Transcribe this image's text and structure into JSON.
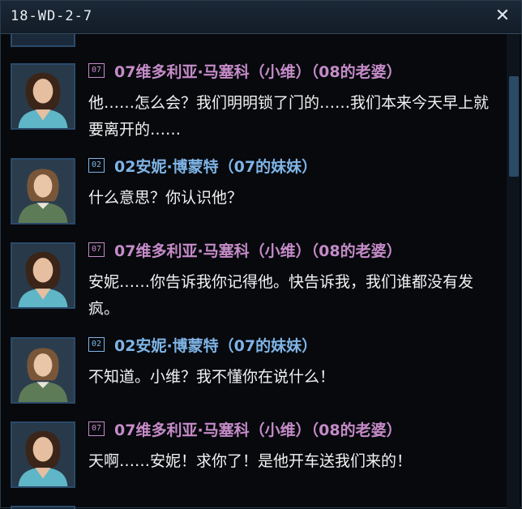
{
  "window": {
    "title": "18-WD-2-7",
    "close_icon": "close-icon"
  },
  "colors": {
    "speaker_07": "#c58bc8",
    "speaker_02": "#7fb4e6",
    "text": "#f2f2f2"
  },
  "entries": [
    {
      "badge": "07",
      "speaker": "07维多利亚·马塞科（小维）（08的老婆）",
      "text": "他……怎么会？我们明明锁了门的……我们本来今天早上就要离开的……"
    },
    {
      "badge": "02",
      "speaker": "02安妮·博蒙特（07的妹妹）",
      "text": "什么意思？你认识他？"
    },
    {
      "badge": "07",
      "speaker": "07维多利亚·马塞科（小维）（08的老婆）",
      "text": "安妮……你告诉我你记得他。快告诉我，我们谁都没有发疯。"
    },
    {
      "badge": "02",
      "speaker": "02安妮·博蒙特（07的妹妹）",
      "text": "不知道。小维？我不懂你在说什么！"
    },
    {
      "badge": "07",
      "speaker": "07维多利亚·马塞科（小维）（08的老婆）",
      "text": "天啊……安妮！求你了！是他开车送我们来的！"
    }
  ]
}
